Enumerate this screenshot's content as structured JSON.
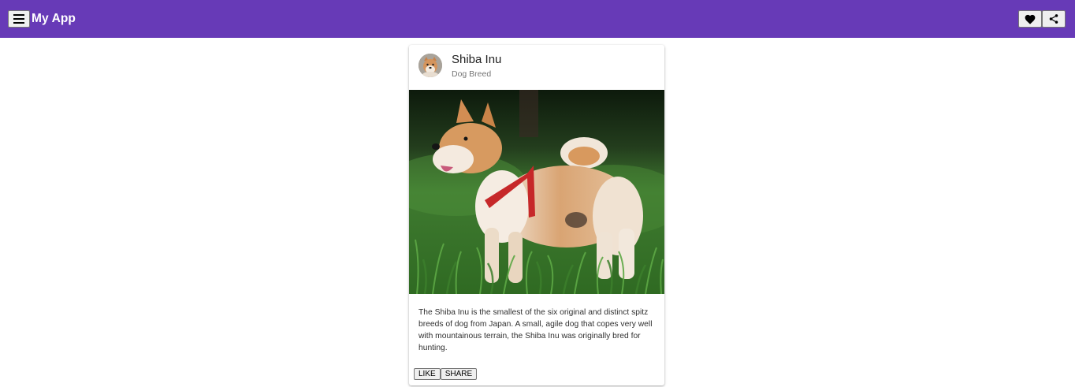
{
  "app_bar": {
    "title": "My App",
    "background": "#673ab7",
    "menu_icon": "menu-icon",
    "actions": [
      {
        "name": "favorite-button",
        "icon": "heart-icon"
      },
      {
        "name": "share-button",
        "icon": "share-icon"
      }
    ]
  },
  "card": {
    "title": "Shiba Inu",
    "subtitle": "Dog Breed",
    "avatar_icon": "shiba-avatar",
    "image": "shiba-inu-photo",
    "description": "The Shiba Inu is the smallest of the six original and distinct spitz breeds of dog from Japan. A small, agile dog that copes very well with mountainous terrain, the Shiba Inu was originally bred for hunting.",
    "actions": {
      "like_label": "LIKE",
      "share_label": "SHARE"
    }
  }
}
